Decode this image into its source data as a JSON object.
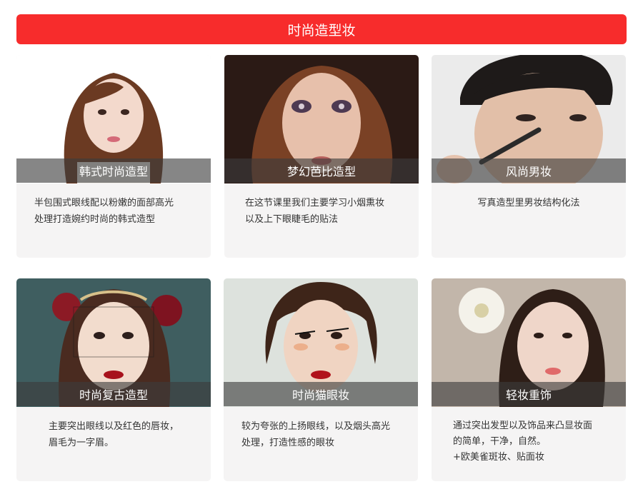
{
  "header": {
    "title": "时尚造型妆",
    "bg_color": "#f72c2c"
  },
  "cards": [
    {
      "title": "韩式时尚造型",
      "photo": "korean-style-portrait",
      "desc_lines": [
        "半包围式眼线配以粉嫩的面部高光",
        "处理打造婉约时尚的韩式造型"
      ]
    },
    {
      "title": "梦幻芭比造型",
      "photo": "barbie-style-portrait",
      "desc_lines": [
        "在这节课里我们主要学习小烟熏妆",
        "以及上下眼睫毛的贴法"
      ]
    },
    {
      "title": "风尚男妆",
      "photo": "male-makeup-portrait",
      "desc_lines": [
        "写真造型里男妆结构化法"
      ]
    },
    {
      "title": "时尚复古造型",
      "photo": "retro-style-portrait",
      "desc_lines": [
        "主要突出眼线以及红色的唇妆，",
        "眉毛为一字眉。"
      ]
    },
    {
      "title": "时尚猫眼妆",
      "photo": "cat-eye-portrait",
      "desc_lines": [
        "较为夸张的上扬眼线，以及烟头高光",
        "处理，打造性感的眼妆"
      ]
    },
    {
      "title": "轻妆重饰",
      "photo": "light-makeup-portrait",
      "desc_lines": [
        "通过突出发型以及饰品来凸显妆面",
        "的简单，干净，自然。",
        "+欧美雀斑妆、贴面妆"
      ]
    }
  ]
}
